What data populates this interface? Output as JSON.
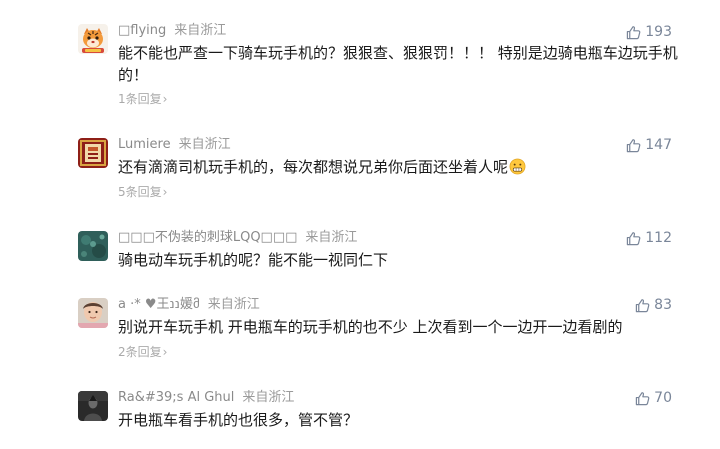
{
  "comments": [
    {
      "username": "□flying",
      "location": "来自浙江",
      "likes": "193",
      "text": "能不能也严查一下骑车玩手机的？狠狠查、狠狠罚！！！ 特别是边骑电瓶车边玩手机的！",
      "replies": "1条回复",
      "avatar_icon": "tiger-cartoon-avatar"
    },
    {
      "username": "Lumiere",
      "location": "来自浙江",
      "likes": "147",
      "text": "还有滴滴司机玩手机的，每次都想说兄弟你后面还坐着人呢",
      "replies": "5条回复",
      "avatar_icon": "red-gold-frame-avatar",
      "emoji_icon": "grimace-emoji"
    },
    {
      "username": "□□□不伪装的刺球LQQ□□□",
      "location": "来自浙江",
      "likes": "112",
      "text": "骑电动车玩手机的呢？能不能一视同仁下",
      "avatar_icon": "teal-texture-avatar"
    },
    {
      "username": "a ·* ♥王ננ媛მ",
      "location": "来自浙江",
      "likes": "83",
      "text": "别说开车玩手机 开电瓶车的玩手机的也不少 上次看到一个一边开一边看剧的",
      "replies": "2条回复",
      "avatar_icon": "child-photo-avatar"
    },
    {
      "username": "Ra&#39;s Al Ghul",
      "location": "来自浙江",
      "likes": "70",
      "text": "开电瓶车看手机的也很多，管不管？",
      "avatar_icon": "dark-figure-avatar"
    }
  ],
  "colors": {
    "text": "#1a1a1a",
    "meta": "#888888",
    "likes": "#7a8699",
    "replies": "#aaaaaa",
    "background": "#ffffff"
  },
  "icons": {
    "like": "thumbs-up-icon",
    "replies_chevron": "chevron-right-icon"
  }
}
